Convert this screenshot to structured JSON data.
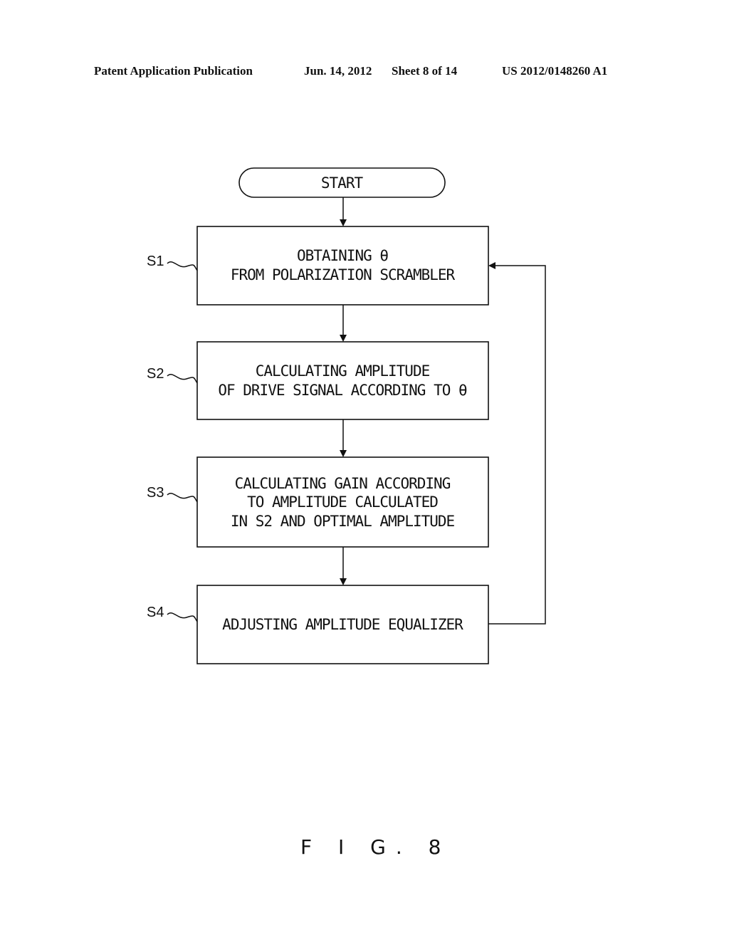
{
  "header": {
    "publication": "Patent Application Publication",
    "date": "Jun. 14, 2012",
    "sheet": "Sheet 8 of 14",
    "number": "US 2012/0148260 A1"
  },
  "flowchart": {
    "start_label": "START",
    "steps": [
      {
        "id": "S1",
        "lines": [
          "OBTAINING θ",
          "FROM POLARIZATION SCRAMBLER"
        ]
      },
      {
        "id": "S2",
        "lines": [
          "CALCULATING AMPLITUDE",
          "OF DRIVE SIGNAL ACCORDING TO θ"
        ]
      },
      {
        "id": "S3",
        "lines": [
          "CALCULATING GAIN ACCORDING",
          "TO AMPLITUDE CALCULATED",
          "IN S2 AND OPTIMAL AMPLITUDE"
        ]
      },
      {
        "id": "S4",
        "lines": [
          "ADJUSTING AMPLITUDE EQUALIZER"
        ]
      }
    ],
    "loop": {
      "from": "S4",
      "to": "S1"
    }
  },
  "figure_label": "F I G. 8"
}
